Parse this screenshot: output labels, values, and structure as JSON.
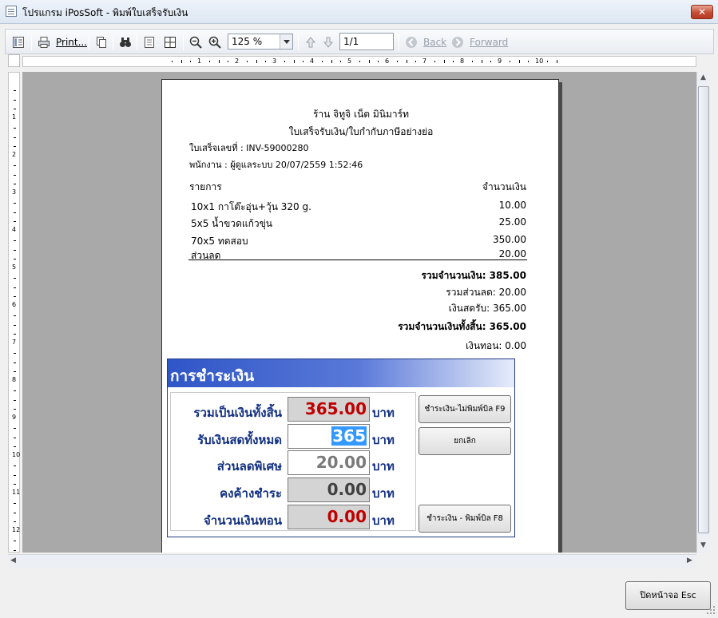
{
  "window": {
    "title": "โปรแกรม iPosSoft - พิมพ์ใบเสร็จรับเงิน",
    "close_glyph": "✕"
  },
  "toolbar": {
    "print_label": "Print...",
    "zoom_value": "125 %",
    "page_value": "1/1",
    "back_label": "Back",
    "forward_label": "Forward"
  },
  "ruler": {
    "h_numbers": [
      "1",
      "2",
      "3",
      "4",
      "5",
      "6",
      "7",
      "8",
      "9",
      "10"
    ],
    "v_numbers": [
      "1",
      "2",
      "3",
      "4",
      "5",
      "6",
      "7",
      "8",
      "9",
      "10",
      "11",
      "12"
    ]
  },
  "receipt": {
    "shop_name": "ร้าน จิทูจิ เน็ต มินิมาร์ท",
    "doc_title": "ใบเสร็จรับเงิน/ใบกำกับภาษีอย่างย่อ",
    "invoice_line": "ใบเสร็จเลขที่ : INV-59000280",
    "staff_line": "พนักงาน : ผู้ดูแลระบบ 20/07/2559 1:52:46",
    "col_item": "รายการ",
    "col_amount": "จำนวนเงิน",
    "items": [
      {
        "name": "10x1 กาโต๊ะอุ่น+วุ้น 320 g.",
        "amount": "10.00"
      },
      {
        "name": "5x5 น้ำขวดแก้วขุ่น",
        "amount": "25.00"
      },
      {
        "name": "70x5 ทดสอบ",
        "amount": "350.00"
      },
      {
        "name": "ส่วนลด",
        "amount": "20.00"
      }
    ],
    "summary": [
      {
        "text": "รวมจำนวนเงิน: 385.00",
        "bold": true
      },
      {
        "text": "รวมส่วนลด: 20.00",
        "bold": false
      },
      {
        "text": "เงินสดรับ: 365.00",
        "bold": false
      },
      {
        "text": "รวมจำนวนเงินทั้งสิ้น: 365.00",
        "bold": true
      },
      {
        "text": "เงินทอน: 0.00",
        "bold": false
      }
    ]
  },
  "payment": {
    "header": "การชำระเงิน",
    "unit": "บาท",
    "rows": [
      {
        "label": "รวมเป็นเงินทั้งสิ้น",
        "value": "365.00",
        "color": "#c00000",
        "bg": "gray"
      },
      {
        "label": "รับเงินสดทั้งหมด",
        "value": "365",
        "color": "#ffffff",
        "bg": "white"
      },
      {
        "label": "ส่วนลดพิเศษ",
        "value": "20.00",
        "color": "#7a7a7a",
        "bg": "white"
      },
      {
        "label": "คงค้างชำระ",
        "value": "0.00",
        "color": "#404040",
        "bg": "gray"
      },
      {
        "label": "จำนวนเงินทอน",
        "value": "0.00",
        "color": "#c00000",
        "bg": "gray"
      }
    ],
    "btn_pay_no_print": "ชำระเงิน-ไม่พิมพ์บิล F9",
    "btn_cancel": "ยกเลิก",
    "btn_pay_print": "ชำระเงิน - พิมพ์บิล F8"
  },
  "footer": {
    "close_button": "ปิดหน้าจอ Esc"
  },
  "colors": {
    "payment_header": "#2f56c7",
    "label_blue": "#123082",
    "value_red": "#c00000"
  }
}
